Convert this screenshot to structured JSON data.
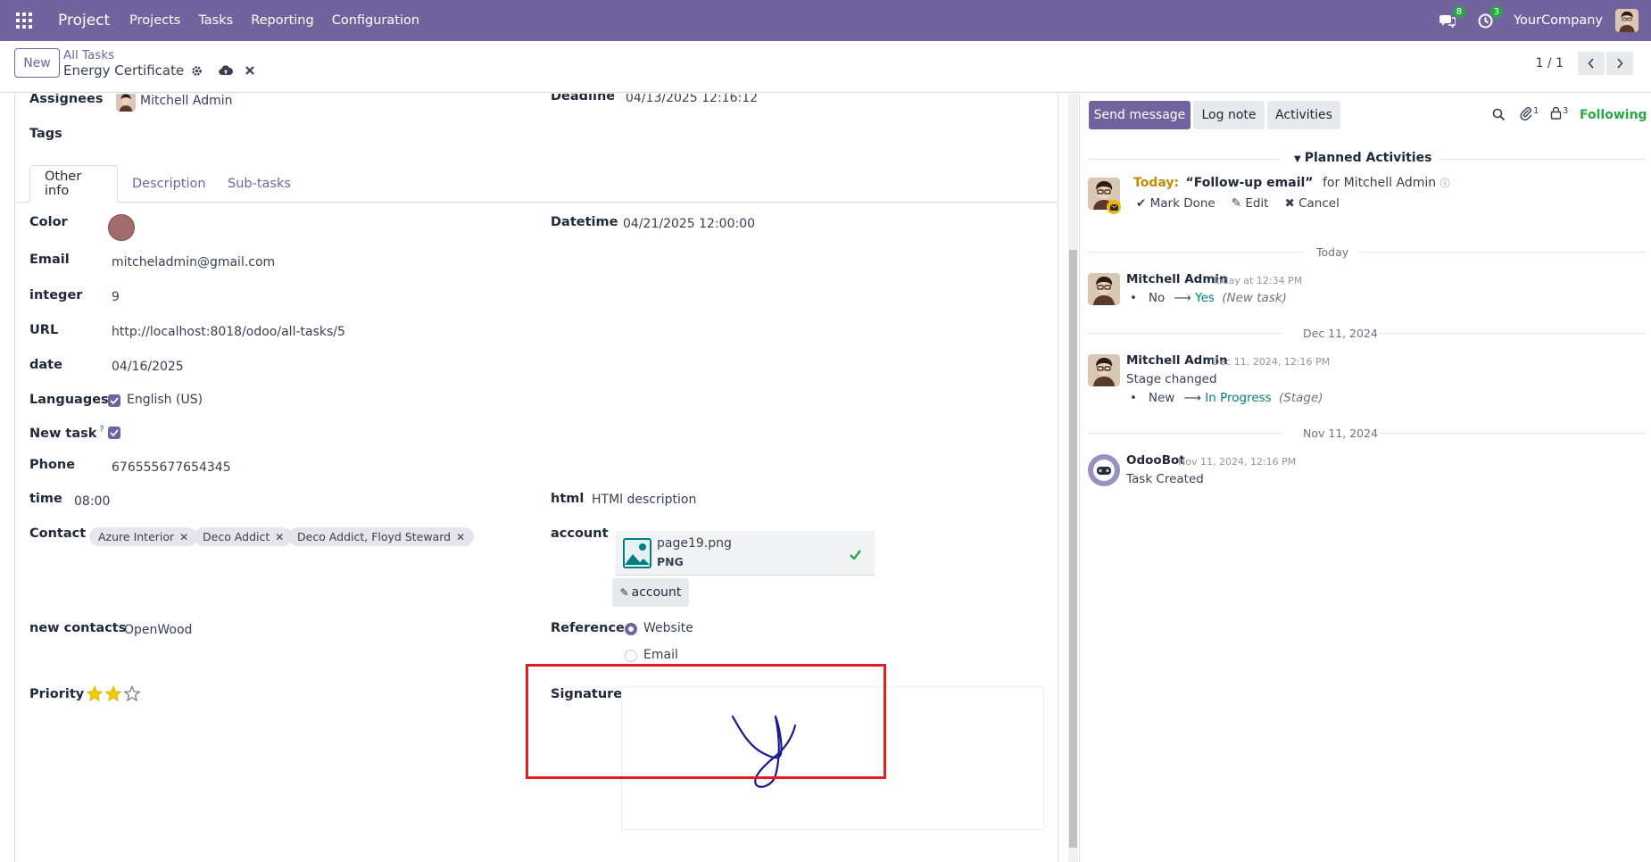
{
  "navbar": {
    "app_name": "Project",
    "menu": [
      "Projects",
      "Tasks",
      "Reporting",
      "Configuration"
    ],
    "messages_count": "8",
    "activities_count": "3",
    "company": "YourCompany",
    "color": "#71639e"
  },
  "control": {
    "new_label": "New",
    "breadcrumb": "All Tasks",
    "record_name": "Energy Certificate",
    "pager": "1 / 1"
  },
  "form": {
    "assignees_label": "Assignees",
    "assignee": "Mitchell Admin",
    "deadline_label": "Deadline",
    "deadline": "04/13/2025 12:16:12",
    "tags_label": "Tags",
    "tabs": [
      "Other info",
      "Description",
      "Sub-tasks"
    ],
    "color_label": "Color",
    "datetime_label": "Datetime",
    "datetime": "04/21/2025 12:00:00",
    "email_label": "Email",
    "email": "mitcheladmin@gmail.com",
    "integer_label": "integer",
    "integer": "9",
    "url_label": "URL",
    "url": "http://localhost:8018/odoo/all-tasks/5",
    "date_label": "date",
    "date": "04/16/2025",
    "languages_label": "Languages",
    "language": "English (US)",
    "new_task_label": "New task",
    "new_task_help": "?",
    "phone_label": "Phone",
    "phone": "676555677654345",
    "time_label": "time",
    "time": "08:00",
    "html_label": "html",
    "html_value": "HTMl description",
    "contact_label": "Contact",
    "contacts": [
      "Azure Interior",
      "Deco Addict",
      "Deco Addict, Floyd Steward"
    ],
    "account_label": "account",
    "attachment_name": "page19.png",
    "attachment_ext": "PNG",
    "account_button": "account",
    "new_contacts_label": "new contacts",
    "new_contacts": "OpenWood",
    "reference_label": "Reference",
    "reference_options": [
      "Website",
      "Email"
    ],
    "reference_selected": "Website",
    "priority_label": "Priority",
    "priority_value": 2,
    "priority_max": 3,
    "signature_label": "Signature"
  },
  "chatter": {
    "send_message": "Send message",
    "log_note": "Log note",
    "activities": "Activities",
    "attachments_count": "1",
    "followers_count": "3",
    "following": "Following",
    "planned_title": "Planned Activities",
    "activity": {
      "when": "Today:",
      "summary": "“Follow-up email”",
      "for": "for Mitchell Admin",
      "mark_done": "Mark Done",
      "edit": "Edit",
      "cancel": "Cancel"
    },
    "messages": [
      {
        "day": "Today",
        "author": "Mitchell Admin",
        "date": "Today at 12:34 PM",
        "old": "No",
        "new": "Yes",
        "field": "(New task)"
      },
      {
        "day": "Dec 11, 2024",
        "author": "Mitchell Admin",
        "date": "Dec 11, 2024, 12:16 PM",
        "text": "Stage changed",
        "old": "New",
        "new": "In Progress",
        "field": "(Stage)"
      },
      {
        "day": "Nov 11, 2024",
        "author": "OdooBot",
        "date": "Nov 11, 2024, 12:16 PM",
        "text": "Task Created"
      }
    ]
  }
}
